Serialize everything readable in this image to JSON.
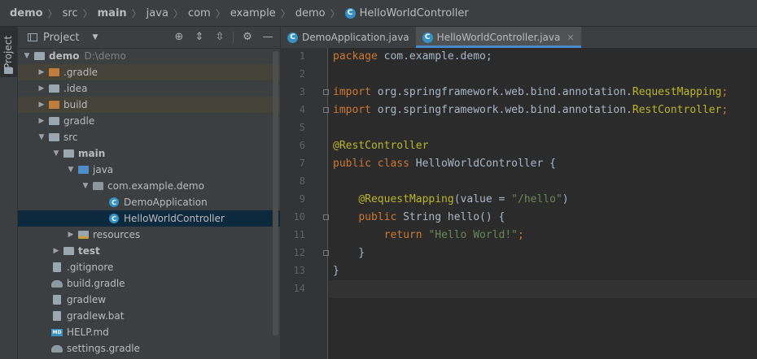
{
  "breadcrumb": {
    "items": [
      "demo",
      "src",
      "main",
      "java",
      "com",
      "example",
      "demo",
      "HelloWorldController"
    ]
  },
  "toolstrip": {
    "project_label": "Project"
  },
  "panel": {
    "title": "Project",
    "tree": [
      {
        "label": "demo",
        "path": "D:\\demo",
        "icon": "folder-icon",
        "bold": true
      },
      {
        "label": ".gradle",
        "icon": "folder-icon"
      },
      {
        "label": ".idea",
        "icon": "folder-icon"
      },
      {
        "label": "build",
        "icon": "folder-icon"
      },
      {
        "label": "gradle",
        "icon": "folder-icon"
      },
      {
        "label": "src",
        "icon": "folder-icon"
      },
      {
        "label": "main",
        "icon": "folder-icon",
        "bold": true
      },
      {
        "label": "java",
        "icon": "folder-icon"
      },
      {
        "label": "com.example.demo",
        "icon": "package-icon"
      },
      {
        "label": "DemoApplication",
        "icon": "class-icon"
      },
      {
        "label": "HelloWorldController",
        "icon": "class-icon"
      },
      {
        "label": "resources",
        "icon": "resources-folder-icon"
      },
      {
        "label": "test",
        "icon": "folder-icon",
        "bold": true
      },
      {
        "label": ".gitignore",
        "icon": "file-icon"
      },
      {
        "label": "build.gradle",
        "icon": "gradle-icon"
      },
      {
        "label": "gradlew",
        "icon": "file-icon"
      },
      {
        "label": "gradlew.bat",
        "icon": "file-icon"
      },
      {
        "label": "HELP.md",
        "icon": "markdown-icon"
      },
      {
        "label": "settings.gradle",
        "icon": "gradle-icon"
      }
    ]
  },
  "editor": {
    "tabs": [
      {
        "label": "DemoApplication.java",
        "active": false
      },
      {
        "label": "HelloWorldController.java",
        "active": true
      }
    ],
    "line_numbers": [
      "1",
      "2",
      "3",
      "4",
      "5",
      "6",
      "7",
      "8",
      "9",
      "10",
      "11",
      "12",
      "13",
      "14"
    ],
    "lines": [
      {
        "p1": "package",
        "p2": " com.example.demo;"
      },
      {
        "p1": ""
      },
      {
        "p1": "import",
        "p2": " org.springframework.web.bind.annotation.",
        "p3": "RequestMapping",
        "p4": ";"
      },
      {
        "p1": "import",
        "p2": " org.springframework.web.bind.annotation.",
        "p3": "RestController",
        "p4": ";"
      },
      {
        "p1": ""
      },
      {
        "p1": "@RestController"
      },
      {
        "p1": "public class",
        "p2": " HelloWorldController ",
        "p3": "{"
      },
      {
        "p1": ""
      },
      {
        "p1": "    ",
        "p2": "@RequestMapping",
        "p3": "(value = ",
        "p4": "\"/hello\"",
        "p5": ")"
      },
      {
        "p1": "    ",
        "p2": "public",
        "p3": " String ",
        "p4": "hello",
        "p5": "() {"
      },
      {
        "p1": "        ",
        "p2": "return",
        "p3": " ",
        "p4": "\"Hello World!\"",
        "p5": ";"
      },
      {
        "p1": "    }"
      },
      {
        "p1": "}"
      },
      {
        "p1": ""
      }
    ]
  }
}
